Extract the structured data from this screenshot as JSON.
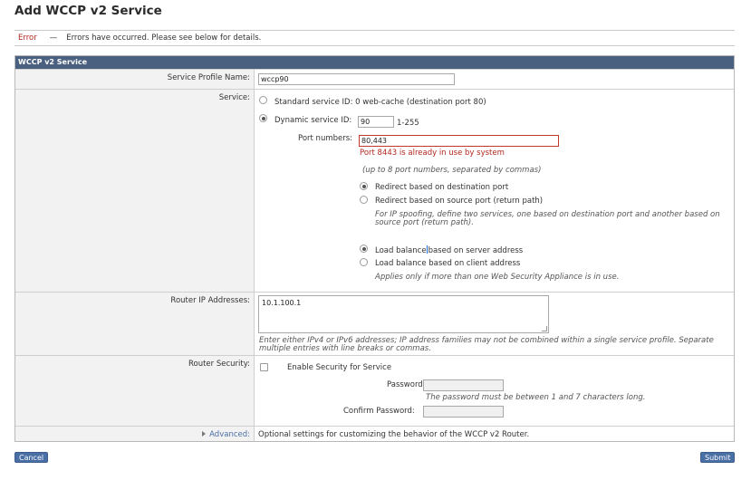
{
  "page": {
    "title": "Add WCCP v2 Service"
  },
  "error": {
    "label": "Error",
    "dash": "—",
    "message": "Errors have occurred. Please see below for details."
  },
  "panel": {
    "header": "WCCP v2 Service"
  },
  "service_profile": {
    "label": "Service Profile Name:",
    "value": "wccp90"
  },
  "service": {
    "label": "Service:",
    "standard_option": "Standard service ID: 0 web-cache (destination port 80)",
    "dynamic_option": "Dynamic service ID:",
    "dynamic_id_value": "90",
    "dynamic_id_range": "1-255",
    "selected": "dynamic",
    "port_numbers_label": "Port numbers:",
    "port_numbers_value": "80,443",
    "port_error": "Port 8443 is already in use by system",
    "port_hint": "(up to 8 port numbers, separated by commas)",
    "redirect_dest": "Redirect based on destination port",
    "redirect_source": "Redirect based on source port (return path)",
    "redirect_selected": "destination",
    "spoofing_note_1": "For IP spoofing, define two services, one based on destination port and another based on",
    "spoofing_note_2": "source port (return path).",
    "lb_server_pre": "Load balance",
    "lb_server_post": "based on server address",
    "lb_client": "Load balance based on client address",
    "lb_selected": "server",
    "lb_note": "Applies only if more than one Web Security Appliance is in use."
  },
  "router_ip": {
    "label": "Router IP Addresses:",
    "value": "10.1.100.1",
    "hint_1": "Enter either IPv4 or IPv6 addresses; IP address families may not be combined within a single service profile. Separate",
    "hint_2": "multiple entries with line breaks or commas."
  },
  "router_security": {
    "label": "Router Security:",
    "enable_label": "Enable Security for Service",
    "enabled": false,
    "password_label": "Password:",
    "password_hint": "The password must be between 1 and 7 characters long.",
    "confirm_label": "Confirm Password:"
  },
  "advanced": {
    "label": "Advanced:",
    "description": "Optional settings for customizing the behavior of the WCCP v2 Router."
  },
  "buttons": {
    "cancel": "Cancel",
    "submit": "Submit"
  },
  "colors": {
    "header_bg": "#4a6080",
    "error_red": "#b3261e",
    "button_blue": "#4a6fa5",
    "label_bg": "#f2f2f2"
  }
}
